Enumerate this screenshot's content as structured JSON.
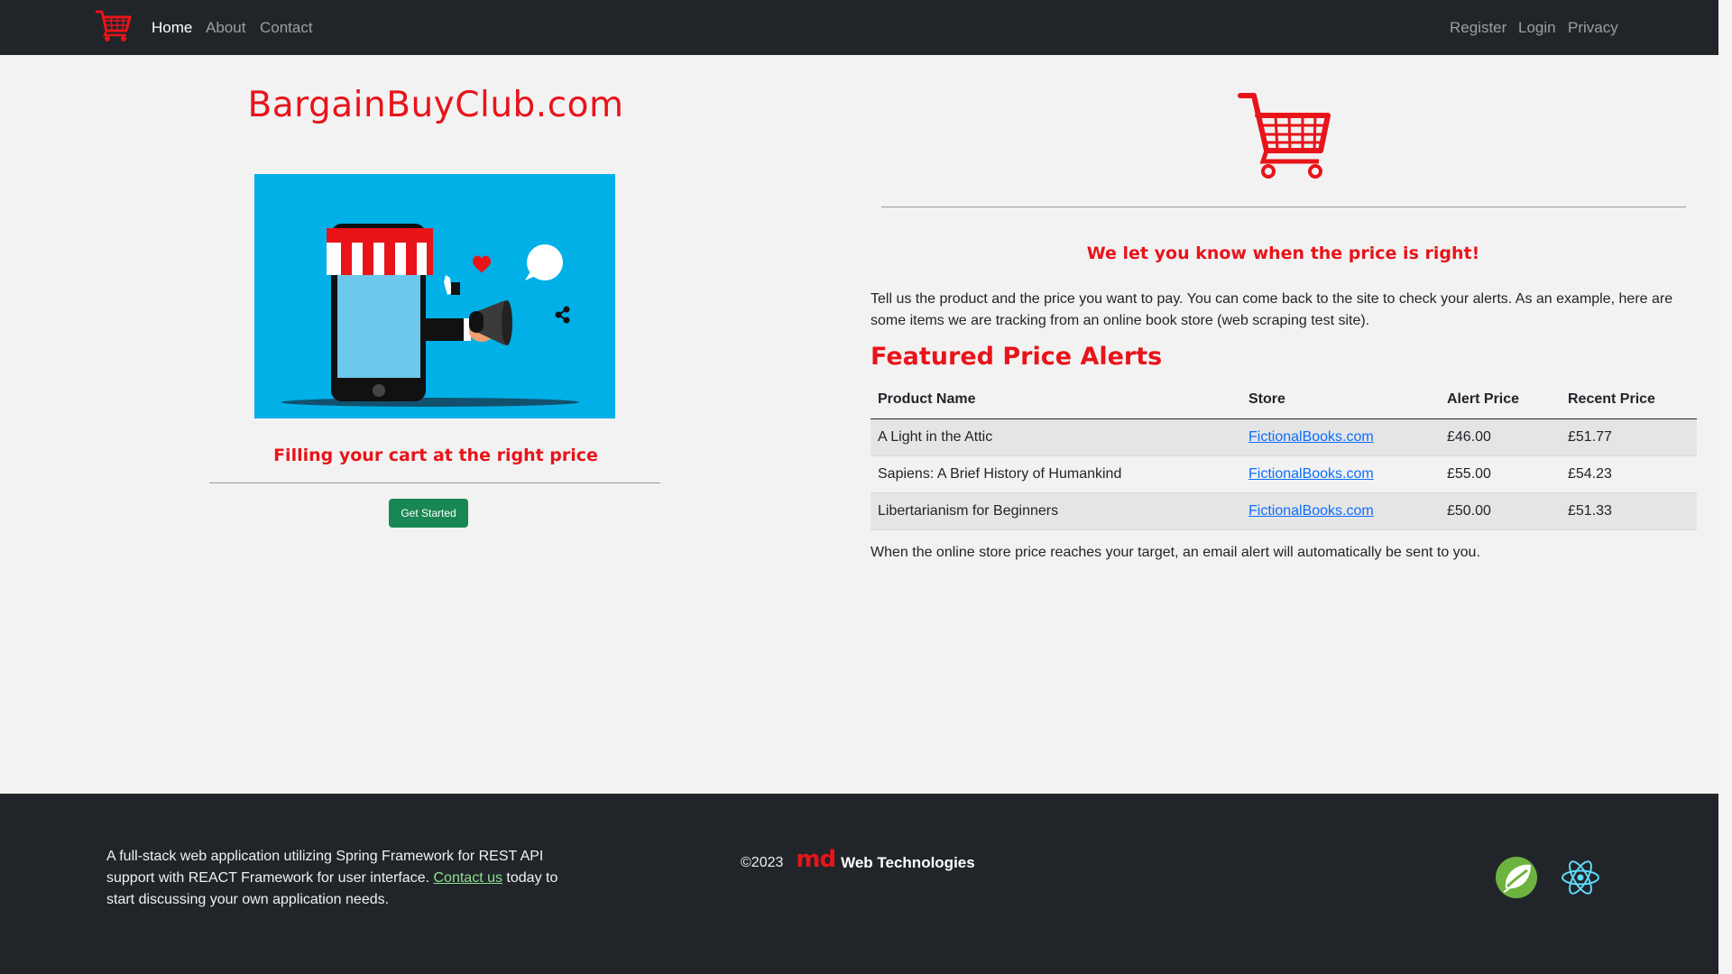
{
  "nav": {
    "logo_icon": "shopping-cart-icon",
    "left_links": [
      "Home",
      "About",
      "Contact"
    ],
    "right_links": [
      "Register",
      "Login",
      "Privacy"
    ],
    "active": "Home"
  },
  "main": {
    "site_title": "BargainBuyClub.com",
    "hero_image": "megaphone-phone-store-illustration",
    "tagline": "Filling your cart at the right price",
    "get_started_label": "Get Started",
    "cart_icon": "shopping-cart-icon",
    "subhead": "We let you know when the price is right!",
    "intro": "Tell us the product and the price you want to pay. You can come back to the site to check your alerts. As an example, here are some items we are tracking from an online book store (web scraping test site).",
    "featured_title": "Featured Price Alerts",
    "table": {
      "headers": [
        "Product Name",
        "Store",
        "Alert Price",
        "Recent Price"
      ],
      "rows": [
        {
          "product": "A Light in the Attic",
          "store": "FictionalBooks.com",
          "alert": "£46.00",
          "recent": "£51.77"
        },
        {
          "product": "Sapiens: A Brief History of Humankind",
          "store": "FictionalBooks.com",
          "alert": "£55.00",
          "recent": "£54.23"
        },
        {
          "product": "Libertarianism for Beginners",
          "store": "FictionalBooks.com",
          "alert": "£50.00",
          "recent": "£51.33"
        }
      ]
    },
    "note": "When the online store price reaches your target, an email alert will automatically be sent to you."
  },
  "footer": {
    "text_before": "A full-stack web application utilizing Spring Framework for REST API support with REACT Framework for user interface. ",
    "link": "Contact us",
    "text_after": " today to start discussing your own application needs.",
    "copyright": "©2023",
    "brand_logo": "md",
    "brand_name": "Web Technologies",
    "icons": [
      "spring-leaf-icon",
      "react-atom-icon"
    ]
  },
  "colors": {
    "accent": "#e8141a",
    "nav_bg": "#212529",
    "button": "#198754",
    "hero_bg": "#00b0e6"
  }
}
